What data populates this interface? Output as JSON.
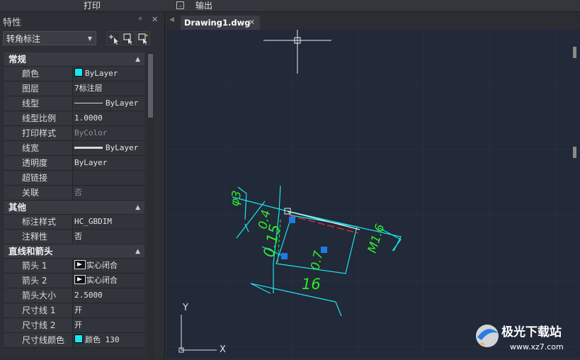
{
  "topbar": {
    "print": "打印",
    "output": "输出"
  },
  "panel": {
    "title": "特性",
    "pin": "ᵖ",
    "close": "✕",
    "selector": "转角标注",
    "sections": [
      {
        "title": "常规",
        "rows": [
          {
            "k": "颜色",
            "v": "ByLayer",
            "type": "color"
          },
          {
            "k": "图层",
            "v": "7标注层"
          },
          {
            "k": "线型",
            "v": "ByLayer",
            "type": "line"
          },
          {
            "k": "线型比例",
            "v": "1.0000"
          },
          {
            "k": "打印样式",
            "v": "ByColor",
            "dim": true
          },
          {
            "k": "线宽",
            "v": "ByLayer",
            "type": "thick"
          },
          {
            "k": "透明度",
            "v": "ByLayer"
          },
          {
            "k": "超链接",
            "v": ""
          },
          {
            "k": "关联",
            "v": "否",
            "dim": true
          }
        ]
      },
      {
        "title": "其他",
        "rows": [
          {
            "k": "标注样式",
            "v": "HC_GBDIM"
          },
          {
            "k": "注释性",
            "v": "否"
          }
        ]
      },
      {
        "title": "直线和箭头",
        "rows": [
          {
            "k": "箭头 1",
            "v": "实心闭合",
            "type": "arrow"
          },
          {
            "k": "箭头 2",
            "v": "实心闭合",
            "type": "arrow"
          },
          {
            "k": "箭头大小",
            "v": "2.5000"
          },
          {
            "k": "尺寸线 1",
            "v": "开"
          },
          {
            "k": "尺寸线 2",
            "v": "开"
          },
          {
            "k": "尺寸线颜色",
            "v": "颜色 130",
            "type": "color"
          }
        ]
      }
    ]
  },
  "tab": {
    "name": "Drawing1.dwg",
    "close": "✕"
  },
  "drawing": {
    "dims": [
      "φ3",
      "0.4",
      "0.15",
      "0.7",
      "16",
      "M1.6"
    ],
    "axes": {
      "x": "X",
      "y": "Y"
    },
    "colors": {
      "cyan": "#19e7f0",
      "green": "#2ee82e",
      "grip": "#1e7be6",
      "red": "#e03030"
    }
  },
  "watermark": {
    "name": "极光下载站",
    "url": "www.xz7.com"
  }
}
